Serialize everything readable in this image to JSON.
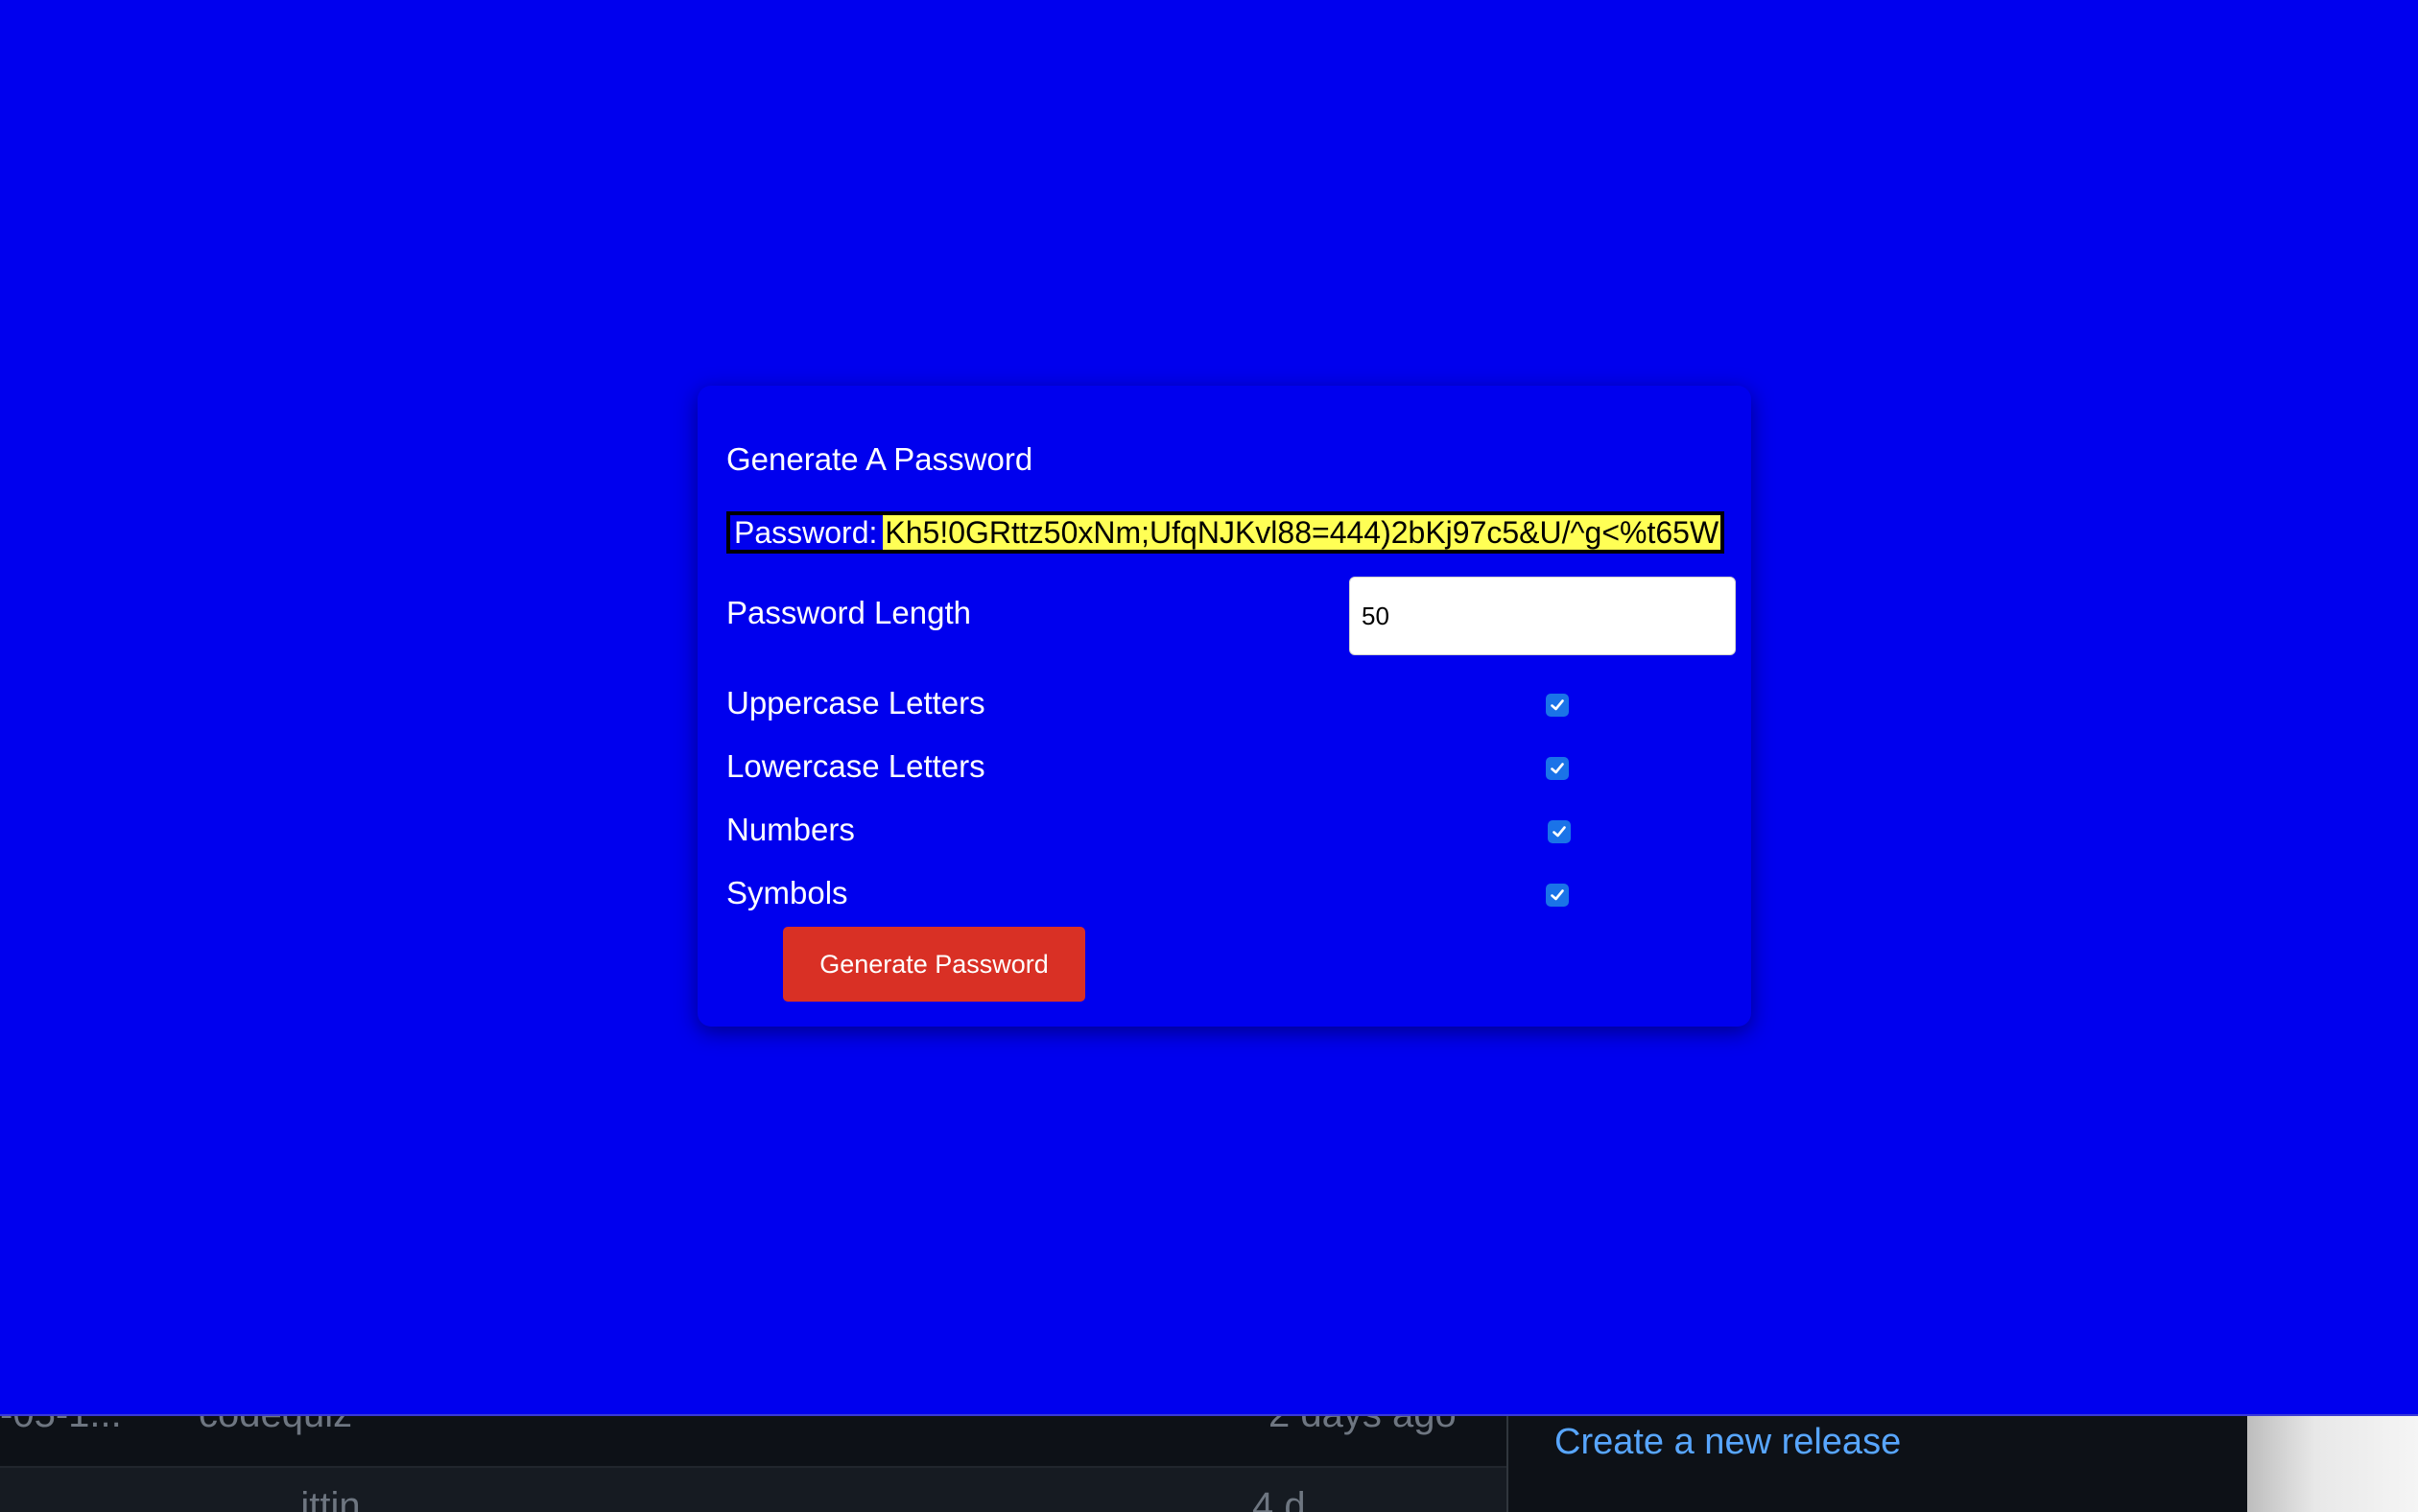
{
  "background_page": {
    "row1_tag": "-05-1...",
    "row1_repo": "codequiz",
    "row1_time": "2 days ago",
    "row2_text": "...ittin",
    "row2_time": "4 d",
    "release_link": "Create a new release"
  },
  "generator": {
    "title": "Generate A Password",
    "password_label": "Password:",
    "password_value": "Kh5!0GRttz50xNm;UfqNJKvl88=444)2bKj97c5&U/^g<%t65W",
    "length_label": "Password Length",
    "length_value": "50",
    "options": [
      {
        "label": "Uppercase Letters",
        "checked": true
      },
      {
        "label": "Lowercase Letters",
        "checked": true
      },
      {
        "label": "Numbers",
        "checked": true
      },
      {
        "label": "Symbols",
        "checked": true
      }
    ],
    "button_label": "Generate Password"
  },
  "colors": {
    "background": "#0000ee",
    "password_highlight": "#ffff55",
    "button": "#d93025",
    "checkbox": "#1a73e8"
  },
  "icons": {
    "checkbox_mark": "checkmark-icon"
  }
}
